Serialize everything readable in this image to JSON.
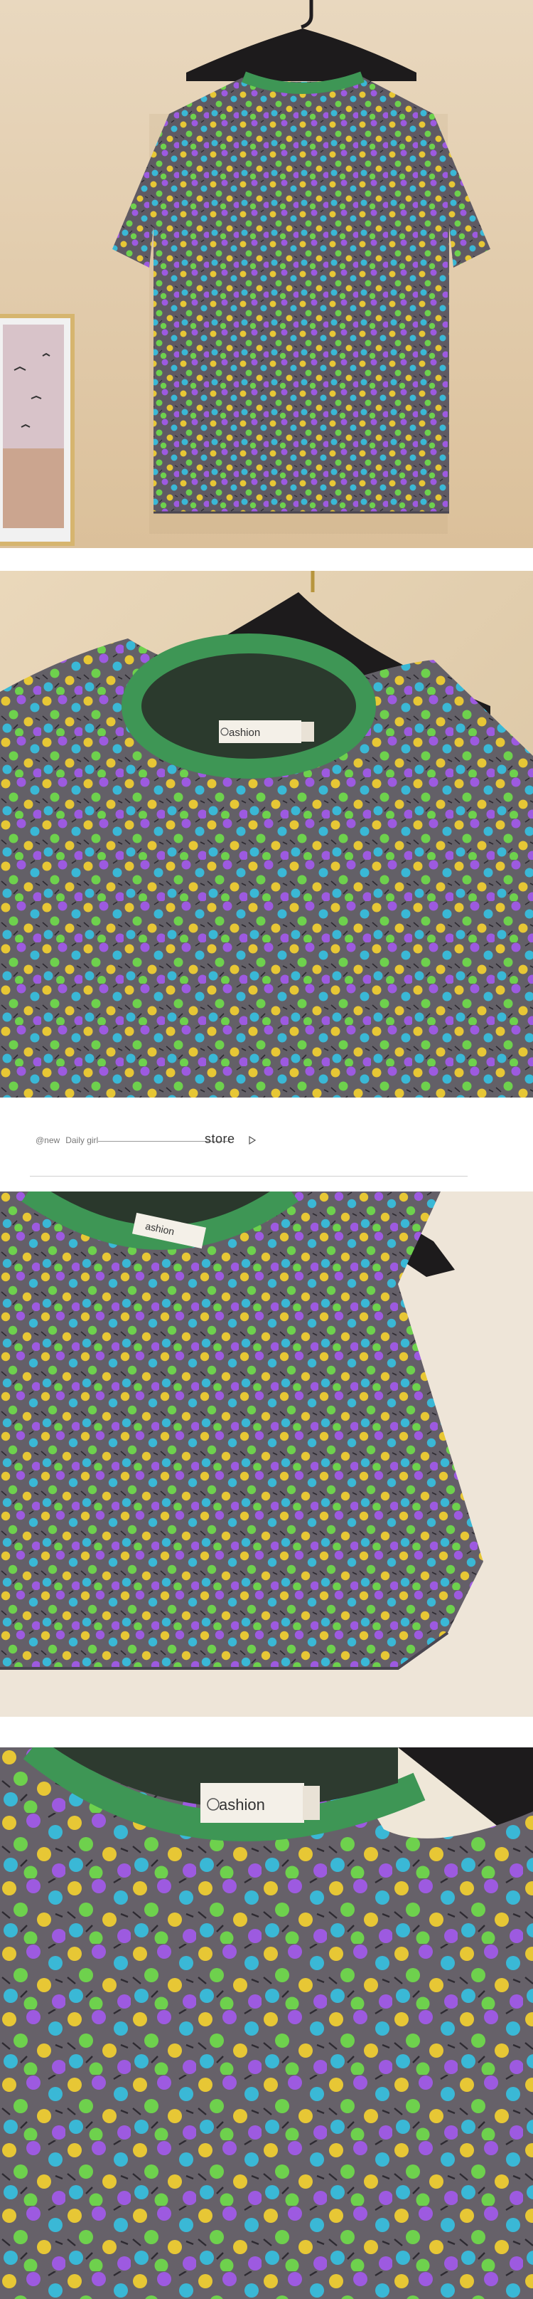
{
  "brand": {
    "tagline": "@new",
    "subtitle": "Daily girl",
    "store_label": "store"
  },
  "labels": {
    "tag_text_1": "ashion",
    "tag_text_2": "ashion"
  },
  "icons": {
    "store_arrow": "play-outline-icon",
    "hanger": "hanger-icon"
  },
  "colors": {
    "fabric": "#5f5a63",
    "collar": "#3e9655",
    "wall": "#e8d3b4",
    "flower_yellow": "#e7c735",
    "flower_purple": "#9d5ae0",
    "flower_cyan": "#3ab8d6",
    "flower_green": "#6ed14d"
  }
}
